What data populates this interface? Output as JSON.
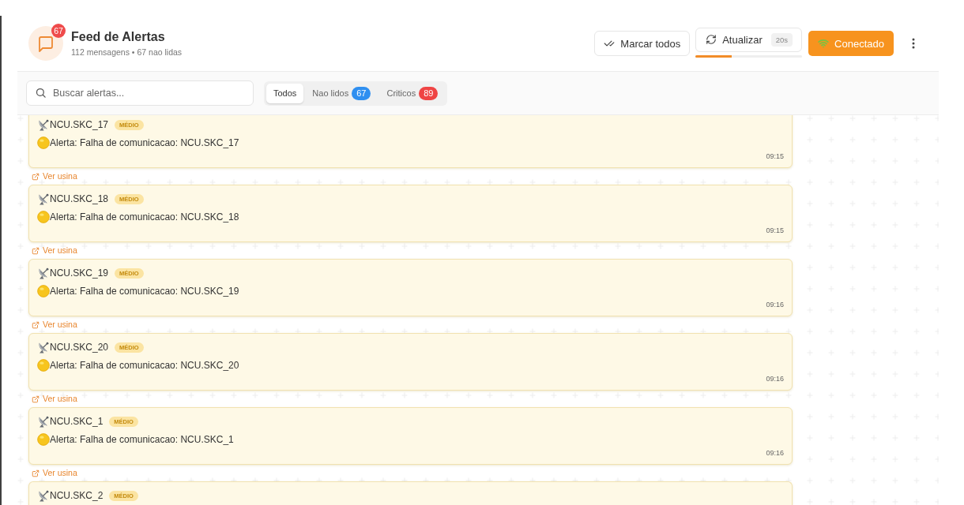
{
  "header": {
    "title": "Feed de Alertas",
    "unread_badge": "67",
    "subtitle": "112 mensagens • 67 nao lidas"
  },
  "actions": {
    "mark_all": {
      "label": "Marcar todos"
    },
    "refresh": {
      "label": "Atualizar",
      "countdown": "20s",
      "level": 0.34
    },
    "connection": {
      "label": "Conectado",
      "connected": true
    }
  },
  "search": {
    "placeholder": "Buscar alertas..."
  },
  "tabs": [
    {
      "label": "Todos",
      "selected": true
    },
    {
      "label": "Nao lidos",
      "count": "67",
      "color": "#2f8ff0",
      "selected": false
    },
    {
      "label": "Criticos",
      "count": "89",
      "color": "#ef4444",
      "selected": false
    }
  ],
  "alerts": [
    {
      "source": "NCU.SKC_17",
      "severity": "MÉDIO",
      "kind": "medium",
      "message": "Alerta: Falha de comunicacao: NCU.SKC_17",
      "time": "09:15",
      "link": "Ver usina"
    },
    {
      "source": "NCU.SKC_18",
      "severity": "MÉDIO",
      "kind": "medium",
      "message": "Alerta: Falha de comunicacao: NCU.SKC_18",
      "time": "09:15",
      "link": "Ver usina"
    },
    {
      "source": "NCU.SKC_19",
      "severity": "MÉDIO",
      "kind": "medium",
      "message": "Alerta: Falha de comunicacao: NCU.SKC_19",
      "time": "09:16",
      "link": "Ver usina"
    },
    {
      "source": "NCU.SKC_20",
      "severity": "MÉDIO",
      "kind": "medium",
      "message": "Alerta: Falha de comunicacao: NCU.SKC_20",
      "time": "09:16",
      "link": "Ver usina"
    },
    {
      "source": "NCU.SKC_1",
      "severity": "MÉDIO",
      "kind": "medium",
      "message": "Alerta: Falha de comunicacao: NCU.SKC_1",
      "time": "09:16",
      "link": "Ver usina"
    },
    {
      "source": "NCU.SKC_2",
      "severity": "MÉDIO",
      "kind": "medium"
    }
  ]
}
